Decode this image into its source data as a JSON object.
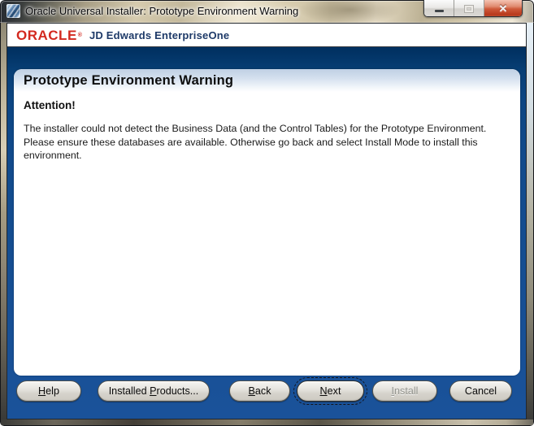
{
  "window": {
    "title": "Oracle Universal Installer: Prototype Environment Warning",
    "controls": {
      "close_glyph": "✕"
    }
  },
  "brand": {
    "logo_text": "ORACLE",
    "trademark": "®",
    "product_name": "JD Edwards EnterpriseOne"
  },
  "page": {
    "heading": "Prototype Environment Warning",
    "attention": "Attention!",
    "message_lines": [
      "The installer could not detect the Business Data (and the Control Tables) for the Prototype Environment.",
      "Please ensure these databases are available. Otherwise go back and select Install Mode to install this",
      "environment."
    ]
  },
  "buttons": [
    {
      "id": "help",
      "before": "",
      "key": "H",
      "after": "elp",
      "enabled": true,
      "focused": false
    },
    {
      "id": "installed-products",
      "before": "Installed ",
      "key": "P",
      "after": "roducts...",
      "enabled": true,
      "focused": false
    },
    {
      "id": "back",
      "before": "",
      "key": "B",
      "after": "ack",
      "enabled": true,
      "focused": false
    },
    {
      "id": "next",
      "before": "",
      "key": "N",
      "after": "ext",
      "enabled": true,
      "focused": true
    },
    {
      "id": "install",
      "before": "",
      "key": "I",
      "after": "nstall",
      "enabled": false,
      "focused": false
    },
    {
      "id": "cancel",
      "before": "Cancel",
      "key": "",
      "after": "",
      "enabled": true,
      "focused": false
    }
  ],
  "colors": {
    "navy_background": "#12498b",
    "oracle_red": "#d3291f",
    "product_navy": "#1e3a68",
    "close_button_red": "#cf5a3a",
    "panel_header_blue": "#bfd0e4"
  }
}
